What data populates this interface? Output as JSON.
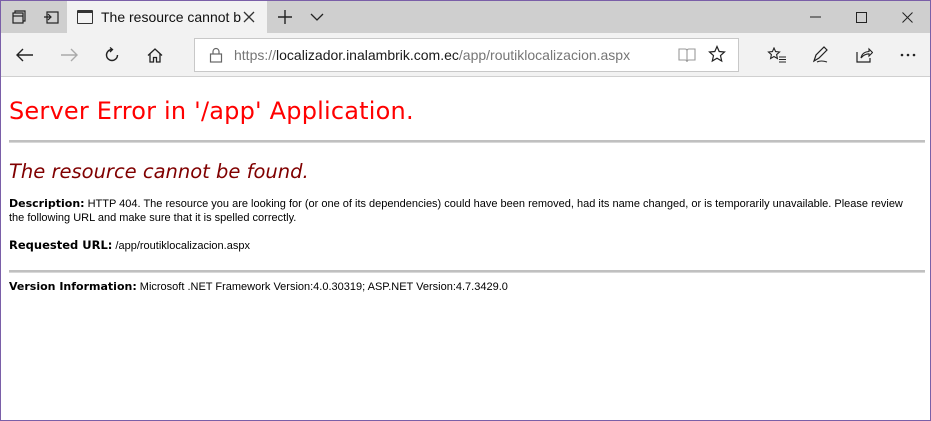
{
  "browser": {
    "tab": {
      "title": "The resource cannot be"
    },
    "address": {
      "scheme": "https://",
      "domain": "localizador.inalambrik.com.ec",
      "path": "/app/routiklocalizacion.aspx"
    }
  },
  "icons": {
    "tab_actions": "tab-actions-icon",
    "set_aside": "set-aside-tabs-icon",
    "page": "page-icon",
    "close": "close-icon",
    "new_tab": "plus-icon",
    "tab_list": "chevron-down-icon",
    "minimize": "minimize-icon",
    "maximize": "maximize-icon",
    "back": "back-arrow-icon",
    "forward": "forward-arrow-icon",
    "refresh": "refresh-icon",
    "home": "home-icon",
    "lock": "lock-icon",
    "reading_view": "book-icon",
    "favorite": "star-icon",
    "favorites_hub": "favorites-list-icon",
    "notes": "pen-icon",
    "share": "share-icon",
    "more": "more-icon"
  },
  "content": {
    "heading": "Server Error in '/app' Application.",
    "subheading": "The resource cannot be found.",
    "description_label": "Description:",
    "description_text": " HTTP 404. The resource you are looking for (or one of its dependencies) could have been removed, had its name changed, or is temporarily unavailable.  Please review the following URL and make sure that it is spelled correctly.",
    "requested_label": "Requested URL:",
    "requested_value": " /app/routiklocalizacion.aspx",
    "version_label": "Version Information:",
    "version_value": " Microsoft .NET Framework Version:4.0.30319; ASP.NET Version:4.7.3429.0"
  },
  "colors": {
    "heading": "#ff0000",
    "subheading": "#800000",
    "titlebar": "#cfcfcf",
    "toolbar": "#f2f2f2"
  }
}
